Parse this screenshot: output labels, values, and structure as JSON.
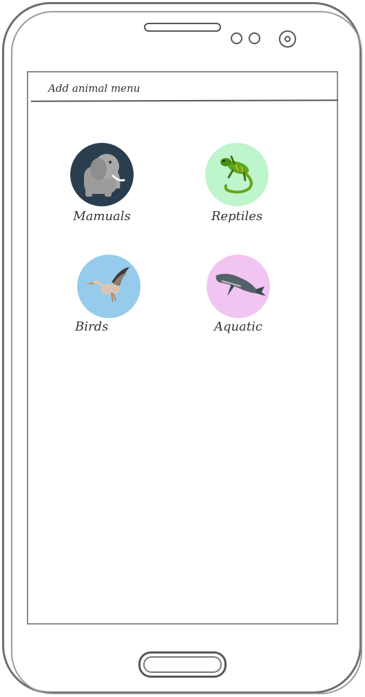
{
  "header": {
    "title": "Add animal menu"
  },
  "categories": [
    {
      "label": "Mamuals",
      "icon": "elephant-icon",
      "color": "#2b3e50"
    },
    {
      "label": "Reptiles",
      "icon": "lizard-icon",
      "color": "#bff5cc"
    },
    {
      "label": "Birds",
      "icon": "pelican-icon",
      "color": "#96cbeb"
    },
    {
      "label": "Aquatic",
      "icon": "whale-icon",
      "color": "#f2c4f2"
    }
  ]
}
